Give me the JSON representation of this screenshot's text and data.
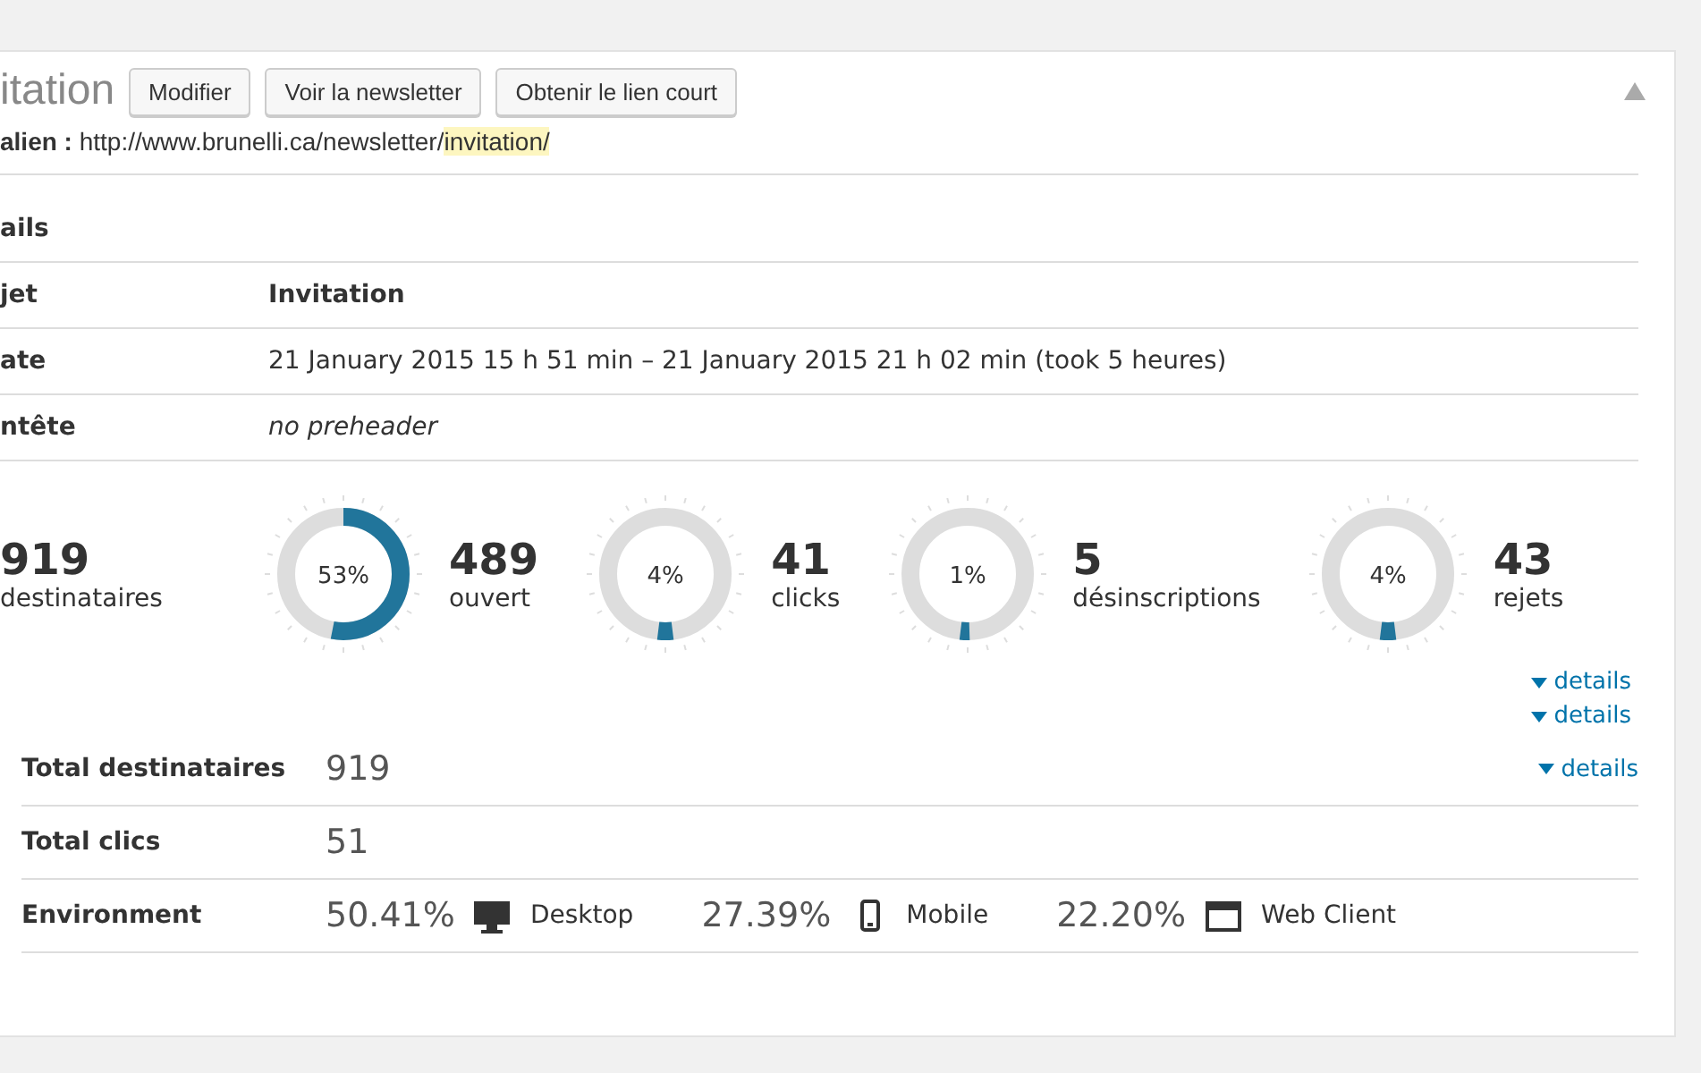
{
  "panel": {
    "title": "itation",
    "buttons": [
      "Modifier",
      "Voir la newsletter",
      "Obtenir le lien court"
    ],
    "collapsed": false
  },
  "permalink": {
    "label": "alien :",
    "url_base": "http://www.brunelli.ca/newsletter/",
    "url_slug": "invitation/"
  },
  "details": {
    "heading": "ails",
    "rows": [
      {
        "label": "jet",
        "value": "Invitation",
        "kind": "bold"
      },
      {
        "label": "ate",
        "value": "21 January 2015 15 h 51 min – 21 January 2015 21 h 02 min (took 5 heures)",
        "kind": "plain"
      },
      {
        "label": "ntête",
        "value": "no preheader",
        "kind": "italic"
      }
    ]
  },
  "stats": {
    "total": {
      "value": "919",
      "label": "destinataires"
    },
    "rings": [
      {
        "percent": "53%",
        "level": 0.53,
        "value": "489",
        "label": "ouvert"
      },
      {
        "percent": "4%",
        "level": 0.04,
        "value": "41",
        "label": "clicks"
      },
      {
        "percent": "1%",
        "level": 0.01,
        "value": "5",
        "label": "désinscriptions"
      },
      {
        "percent": "4%",
        "level": 0.04,
        "value": "43",
        "label": "rejets"
      }
    ]
  },
  "details_links": [
    "details",
    "details",
    "details"
  ],
  "summary": [
    {
      "label": "Total destinataires",
      "value": "919"
    },
    {
      "label": "Total clics",
      "value": "51"
    },
    {
      "label": "Environment",
      "environments": [
        {
          "percent": "50.41%",
          "device": "Desktop",
          "kind": "desktop"
        },
        {
          "percent": "27.39%",
          "device": "Mobile",
          "kind": "mobile"
        },
        {
          "percent": "22.20%",
          "device": "Web Client",
          "kind": "web"
        }
      ]
    }
  ]
}
